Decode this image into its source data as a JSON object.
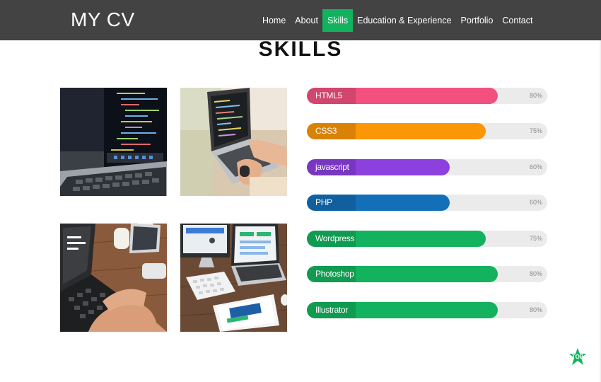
{
  "brand": "MY CV",
  "nav": {
    "items": [
      "Home",
      "About",
      "Skills",
      "Education & Experience",
      "Portfolio",
      "Contact"
    ],
    "active": "Skills",
    "accent_color": "#13b25e"
  },
  "section_title": "SKILLS",
  "photos": [
    {
      "icon": "laptop-code-dark-photo"
    },
    {
      "icon": "laptop-code-desk-photo"
    },
    {
      "icon": "laptop-typing-photo"
    },
    {
      "icon": "imac-workspace-photo"
    }
  ],
  "skills": [
    {
      "name": "HTML5",
      "percent": 80,
      "percent_label": "80%",
      "color": "#f2507e"
    },
    {
      "name": "CSS3",
      "percent": 75,
      "percent_label": "75%",
      "color": "#fb9607"
    },
    {
      "name": "javascript",
      "percent": 60,
      "percent_label": "60%",
      "color": "#8c40de"
    },
    {
      "name": "PHP",
      "percent": 60,
      "percent_label": "60%",
      "color": "#136fb8"
    },
    {
      "name": "Wordpress",
      "percent": 75,
      "percent_label": "75%",
      "color": "#13b25e"
    },
    {
      "name": "Photoshop",
      "percent": 80,
      "percent_label": "80%",
      "color": "#13b25e"
    },
    {
      "name": "Illustrator",
      "percent": 80,
      "percent_label": "80%",
      "color": "#13b25e"
    }
  ],
  "back_to_top": {
    "label": "TOP",
    "color": "#13b25e",
    "icon": "star-icon"
  }
}
